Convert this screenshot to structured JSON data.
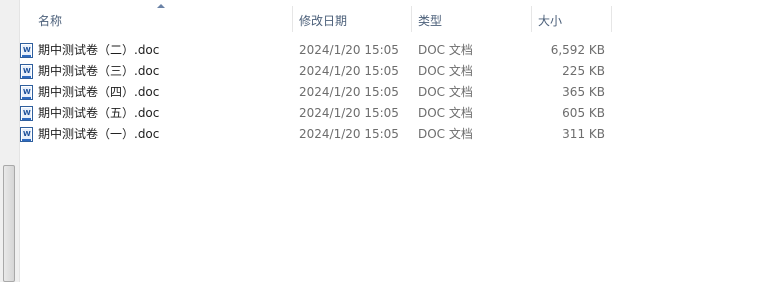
{
  "header": {
    "columns": [
      {
        "label": "名称"
      },
      {
        "label": "修改日期"
      },
      {
        "label": "类型"
      },
      {
        "label": "大小"
      }
    ],
    "sort_column": "名称",
    "sort_direction": "ascending"
  },
  "files": [
    {
      "name": "期中测试卷（二）.doc",
      "modified": "2024/1/20 15:05",
      "type": "DOC 文档",
      "size": "6,592 KB",
      "icon": "word-doc-icon"
    },
    {
      "name": "期中测试卷（三）.doc",
      "modified": "2024/1/20 15:05",
      "type": "DOC 文档",
      "size": "225 KB",
      "icon": "word-doc-icon"
    },
    {
      "name": "期中测试卷（四）.doc",
      "modified": "2024/1/20 15:05",
      "type": "DOC 文档",
      "size": "365 KB",
      "icon": "word-doc-icon"
    },
    {
      "name": "期中测试卷（五）.doc",
      "modified": "2024/1/20 15:05",
      "type": "DOC 文档",
      "size": "605 KB",
      "icon": "word-doc-icon"
    },
    {
      "name": "期中测试卷（一）.doc",
      "modified": "2024/1/20 15:05",
      "type": "DOC 文档",
      "size": "311 KB",
      "icon": "word-doc-icon"
    }
  ],
  "colors": {
    "header_text": "#4c607a",
    "secondary_text": "#6d6d6d",
    "primary_text": "#1e1e1e",
    "icon_blue": "#2f5f9e"
  }
}
